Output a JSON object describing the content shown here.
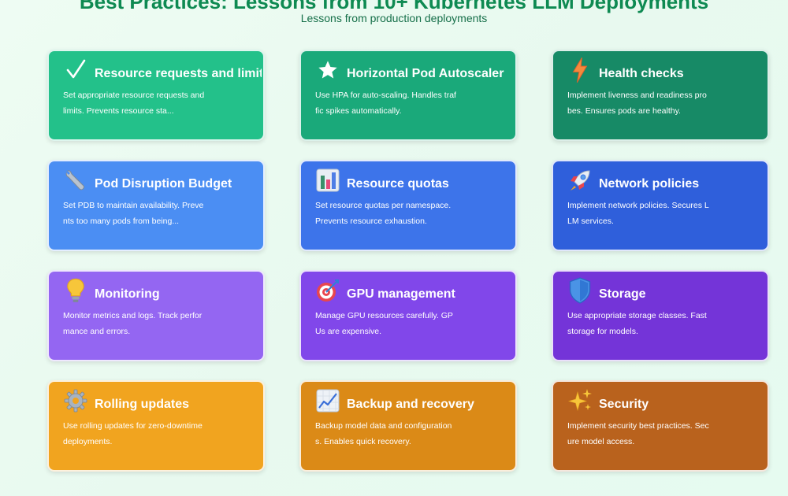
{
  "header": {
    "title": "Best Practices: Lessons from 10+ Kubernetes LLM Deployments",
    "subtitle": "Lessons from production deployments"
  },
  "cards": [
    {
      "title": "Resource requests and limits",
      "description": "Set appropriate resource requests and limits. Prevents resource sta...",
      "icon": "check-icon",
      "color": "#23c18a"
    },
    {
      "title": "Horizontal Pod Autoscaler",
      "description": "Use HPA for auto-scaling. Handles traffic spikes automatically.",
      "icon": "star-icon",
      "color": "#1aa97a"
    },
    {
      "title": "Health checks",
      "description": "Implement liveness and readiness probes. Ensures pods are healthy.",
      "icon": "lightning-icon",
      "color": "#178a66"
    },
    {
      "title": "Pod Disruption Budget",
      "description": "Set PDB to maintain availability. Prevents too many pods from being...",
      "icon": "wrench-icon",
      "color": "#4b8ef3"
    },
    {
      "title": "Resource quotas",
      "description": "Set resource quotas per namespace. Prevents resource exhaustion.",
      "icon": "bar-chart-icon",
      "color": "#3d74ea"
    },
    {
      "title": "Network policies",
      "description": "Implement network policies. Secures LLM services.",
      "icon": "rocket-icon",
      "color": "#2f5fdb"
    },
    {
      "title": "Monitoring",
      "description": "Monitor metrics and logs. Track performance and errors.",
      "icon": "lightbulb-icon",
      "color": "#9466f2"
    },
    {
      "title": "GPU management",
      "description": "Manage GPU resources carefully. GPUs are expensive.",
      "icon": "target-icon",
      "color": "#8147ea"
    },
    {
      "title": "Storage",
      "description": "Use appropriate storage classes. Fast storage for models.",
      "icon": "shield-icon",
      "color": "#7434d8"
    },
    {
      "title": "Rolling updates",
      "description": "Use rolling updates for zero-downtime deployments.",
      "icon": "gear-icon",
      "color": "#f1a41f"
    },
    {
      "title": "Backup and recovery",
      "description": "Backup model data and configurations. Enables quick recovery.",
      "icon": "line-chart-icon",
      "color": "#db8a17"
    },
    {
      "title": "Security",
      "description": "Implement security best practices. Secure model access.",
      "icon": "sparkles-icon",
      "color": "#b9621d"
    }
  ]
}
